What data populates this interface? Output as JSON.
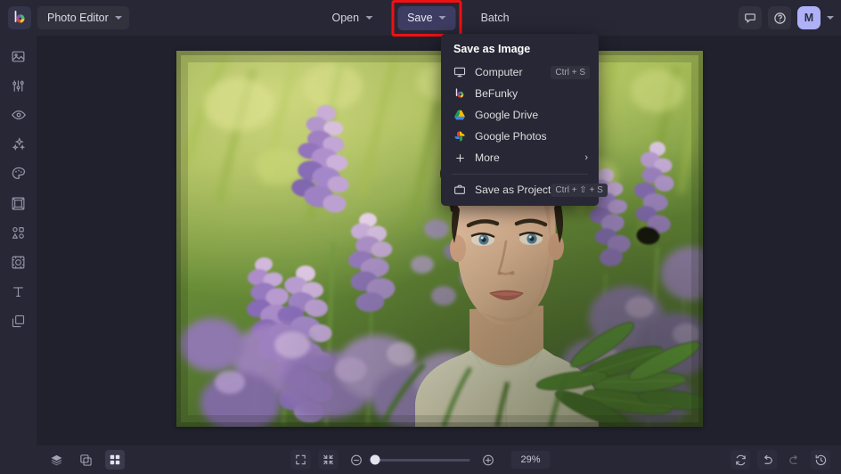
{
  "app": {
    "title": "BeFunky Photo Editor",
    "logo_icon": "befunky-logo-icon"
  },
  "topbar": {
    "app_selector_label": "Photo Editor",
    "app_selector_icon": "chevron-down-icon",
    "open_label": "Open",
    "open_icon": "chevron-down-icon",
    "save_label": "Save",
    "save_icon": "chevron-down-icon",
    "batch_label": "Batch",
    "feedback_icon": "feedback-chat-icon",
    "help_icon": "help-question-icon",
    "avatar_initial": "M",
    "account_chevron_icon": "chevron-down-icon",
    "highlight_color": "#ee1111",
    "avatar_color": "#aeb1f7",
    "save_active_bg": "#3d3d63"
  },
  "sidebar": {
    "items": [
      {
        "name": "edit",
        "icon": "image-photo-icon"
      },
      {
        "name": "adjust",
        "icon": "sliders-adjust-icon"
      },
      {
        "name": "touch-up",
        "icon": "eye-retouch-icon"
      },
      {
        "name": "effects",
        "icon": "sparkles-effects-icon"
      },
      {
        "name": "artsy",
        "icon": "palette-artsy-icon"
      },
      {
        "name": "frames",
        "icon": "frame-border-icon"
      },
      {
        "name": "graphics",
        "icon": "shapes-graphics-icon"
      },
      {
        "name": "overlays",
        "icon": "overlay-image-icon"
      },
      {
        "name": "text",
        "icon": "text-t-icon"
      },
      {
        "name": "layers",
        "icon": "layers-stack-icon"
      }
    ]
  },
  "menu": {
    "title": "Save as Image",
    "items": [
      {
        "label": "Computer",
        "icon": "monitor-computer-icon",
        "shortcut": "Ctrl + S"
      },
      {
        "label": "BeFunky",
        "icon": "befunky-logo-icon",
        "shortcut": ""
      },
      {
        "label": "Google Drive",
        "icon": "google-drive-icon",
        "shortcut": ""
      },
      {
        "label": "Google Photos",
        "icon": "google-photos-icon",
        "shortcut": ""
      },
      {
        "label": "More",
        "icon": "plus-icon",
        "shortcut": "",
        "submenu_icon": "chevron-right-icon"
      }
    ],
    "project": {
      "label": "Save as Project",
      "icon": "briefcase-project-icon",
      "shortcut": "Ctrl + ⇧ + S"
    }
  },
  "bottombar": {
    "layers_icon": "layers-stack-icon",
    "compare_icon": "compare-toggle-icon",
    "grid_icon": "grid-view-icon",
    "fit_icon": "fit-screen-icon",
    "shrink_icon": "shrink-to-fit-icon",
    "zoom_out_icon": "zoom-out-minus-icon",
    "zoom_in_icon": "zoom-in-plus-icon",
    "zoom_level": "29%",
    "zoom_slider_position": 0,
    "reset_icon": "reset-refresh-icon",
    "undo_icon": "undo-arrow-icon",
    "redo_icon": "redo-arrow-icon",
    "history_icon": "history-clock-icon"
  },
  "canvas": {
    "photo_alt": "Young man with curly dark hair standing in a field of purple lupine flowers and green foliage",
    "background_color": "#21212e"
  }
}
